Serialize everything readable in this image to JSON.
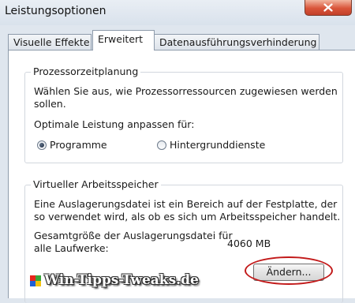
{
  "window": {
    "title": "Leistungsoptionen"
  },
  "tabs": [
    {
      "label": "Visuelle Effekte"
    },
    {
      "label": "Erweitert"
    },
    {
      "label": "Datenausführungsverhinderung"
    }
  ],
  "processor_scheduling": {
    "legend": "Prozessorzeitplanung",
    "description_line1": "Wählen Sie aus, wie Prozessorressourcen zugewiesen werden",
    "description_line2": "sollen.",
    "adjust_label": "Optimale Leistung anpassen für:",
    "option_programs": "Programme",
    "option_background": "Hintergrunddienste",
    "selected": "Programme"
  },
  "virtual_memory": {
    "legend": "Virtueller Arbeitsspeicher",
    "description_line1": "Eine Auslagerungsdatei ist ein Bereich auf der Festplatte, der",
    "description_line2": "so verwendet wird, als ob es sich um Arbeitsspeicher handelt.",
    "total_label_line1": "Gesamtgröße der Auslagerungsdatei für",
    "total_label_line2": "alle Laufwerke:",
    "total_value": "4060 MB",
    "change_button": "Ändern..."
  },
  "watermark": {
    "text": "Win-Tipps-Tweaks.de"
  },
  "colors": {
    "highlight": "#c21a1a",
    "close_button": "#d9553a",
    "window_frame": "#dfe6ee"
  },
  "icons": [
    "close-icon",
    "radio-selected-icon",
    "radio-unselected-icon",
    "watermark-logo-icon"
  ]
}
